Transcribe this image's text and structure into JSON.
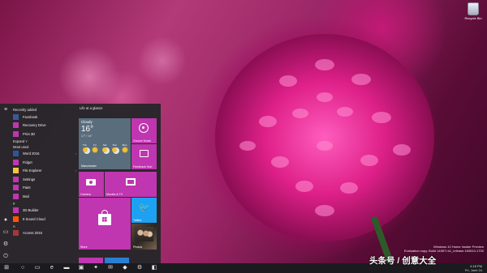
{
  "desktop": {
    "recycle_bin_label": "Recycle Bin",
    "build_info": [
      "Windows 10 Home Insider Preview",
      "Evaluation copy. Build 14367.rs1_release.160613-1700"
    ],
    "wallpaper_colors": {
      "accent": "#c035b0",
      "petal": "#e0218a",
      "bg": "#7a1447"
    }
  },
  "start_menu": {
    "recently_added_label": "Recently added",
    "recently_added": [
      "Facebook",
      "Recovery Drive",
      "Print 3D"
    ],
    "expand_label": "Expand",
    "most_used_label": "Most used",
    "most_used": [
      "Word 2016",
      "Fidget",
      "File Explorer",
      "Settings",
      "Paint",
      "Mail"
    ],
    "letter_header": "#",
    "apps": [
      "3D Builder",
      "8 Sound Cloud"
    ],
    "letter_a_header": "A",
    "apps_a": [
      "Access 2016"
    ],
    "tiles_group_label": "Life at a glance",
    "tiles": {
      "weather": {
        "condition": "Cloudy",
        "temp": "16°",
        "hi_lo": "17° / 14°",
        "city": "Manchester",
        "days": [
          "Thu",
          "Fri",
          "Sat",
          "Sun",
          "Mon"
        ]
      },
      "groove": "Groove Music",
      "feedback": "Feedback Hub",
      "camera": "Camera",
      "movies": "Movies & TV",
      "store": "Store",
      "twitter": "Twitter",
      "photos": "Photos"
    }
  },
  "taskbar": {
    "time": "4:18 PM",
    "date": "Fri, June 24"
  },
  "watermark": "头条号 / 创意大全"
}
